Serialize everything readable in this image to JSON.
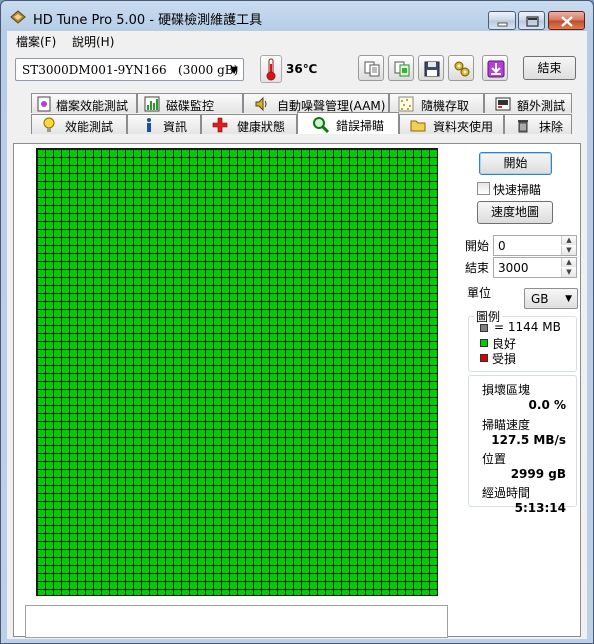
{
  "window": {
    "title": "HD Tune Pro 5.00 - 硬碟檢測維護工具"
  },
  "menu": {
    "file": "檔案(F)",
    "help": "說明(H)"
  },
  "toolbar": {
    "drive": "ST3000DM001-9YN166   (3000 gB)",
    "temperature": "36℃",
    "exit_label": "結束"
  },
  "tabs_top": [
    {
      "label": "檔案效能測試",
      "icon": "file-benchmark-icon"
    },
    {
      "label": "磁碟監控",
      "icon": "disk-monitor-icon"
    },
    {
      "label": "自動噪聲管理(AAM)",
      "icon": "speaker-icon"
    },
    {
      "label": "隨機存取",
      "icon": "random-access-icon"
    },
    {
      "label": "額外測試",
      "icon": "extra-tests-icon"
    }
  ],
  "tabs_bottom": [
    {
      "label": "效能測試",
      "icon": "lightbulb-icon"
    },
    {
      "label": "資訊",
      "icon": "info-icon"
    },
    {
      "label": "健康狀態",
      "icon": "health-cross-icon"
    },
    {
      "label": "錯誤掃瞄",
      "icon": "magnifier-icon",
      "active": true
    },
    {
      "label": "資料夾使用",
      "icon": "folder-icon"
    },
    {
      "label": "抹除",
      "icon": "trash-icon"
    }
  ],
  "error_scan": {
    "start_label": "開始",
    "quick_scan_label": "快速掃瞄",
    "quick_scan_checked": false,
    "speed_map_label": "速度地圖",
    "start_field_label": "開始",
    "start_value": "0",
    "end_field_label": "結束",
    "end_value": "3000",
    "unit_label": "單位",
    "unit_value": "GB",
    "legend": {
      "title": "圖例",
      "block_size": "= 1144 MB",
      "good": "良好",
      "damaged": "受損"
    },
    "stats": {
      "damaged_blocks_label": "損壞區塊",
      "damaged_blocks_value": "0.0 %",
      "scan_speed_label": "掃瞄速度",
      "scan_speed_value": "127.5 MB/s",
      "position_label": "位置",
      "position_value": "2999 gB",
      "elapsed_label": "經過時間",
      "elapsed_value": "5:13:14"
    }
  },
  "colors": {
    "good_block": "#00cc00",
    "damaged_block": "#dd0000",
    "grid_line": "#1a1a1a"
  }
}
